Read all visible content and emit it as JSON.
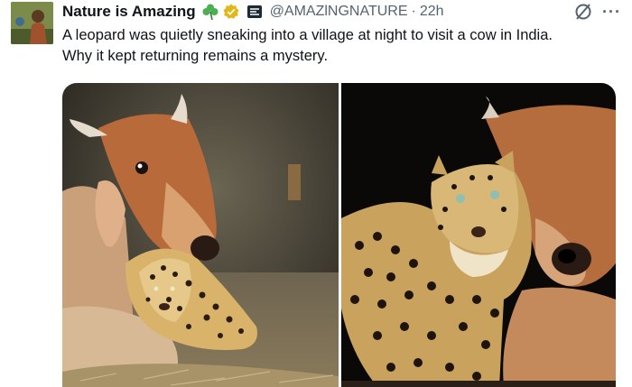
{
  "tweet": {
    "display_name": "Nature is Amazing",
    "handle": "@AMAZlNGNATURE",
    "separator": "·",
    "time": "22h",
    "more_label": "···",
    "text_line1": "A leopard was quietly sneaking into a village at night to visit a cow in India.",
    "text_line2": "Why it kept returning remains a mystery.",
    "icons": {
      "clover": "shamrock-icon",
      "verified": "gold-verified-badge-icon",
      "affiliation": "affiliate-badge-icon",
      "grok": "grok-icon",
      "more": "more-options-icon"
    }
  },
  "colors": {
    "text": "#0f1419",
    "secondary": "#536471",
    "verified": "#e2b719",
    "clover": "#4caf50"
  }
}
